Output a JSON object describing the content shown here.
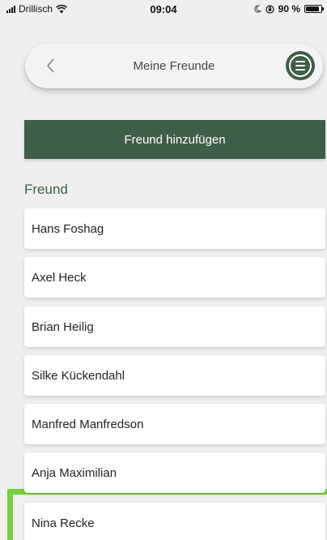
{
  "status_bar": {
    "carrier": "Drillisch",
    "time": "09:04",
    "battery": "90 %",
    "battery_level": 0.9
  },
  "header": {
    "title": "Meine Freunde",
    "back_icon": "chevron-left-icon",
    "menu_icon": "hamburger-menu-icon"
  },
  "actions": {
    "add_friend_label": "Freund hinzufügen"
  },
  "section": {
    "label": "Freund"
  },
  "friends": [
    "Hans Foshag",
    "Axel Heck",
    "Brian Heilig",
    "Silke Kückendahl",
    "Manfred Manfredson",
    "Anja Maximilian",
    "Nina Recke"
  ],
  "colors": {
    "brand_green": "#3f5e47",
    "highlight_green": "#72d23e",
    "background": "#efefef"
  }
}
